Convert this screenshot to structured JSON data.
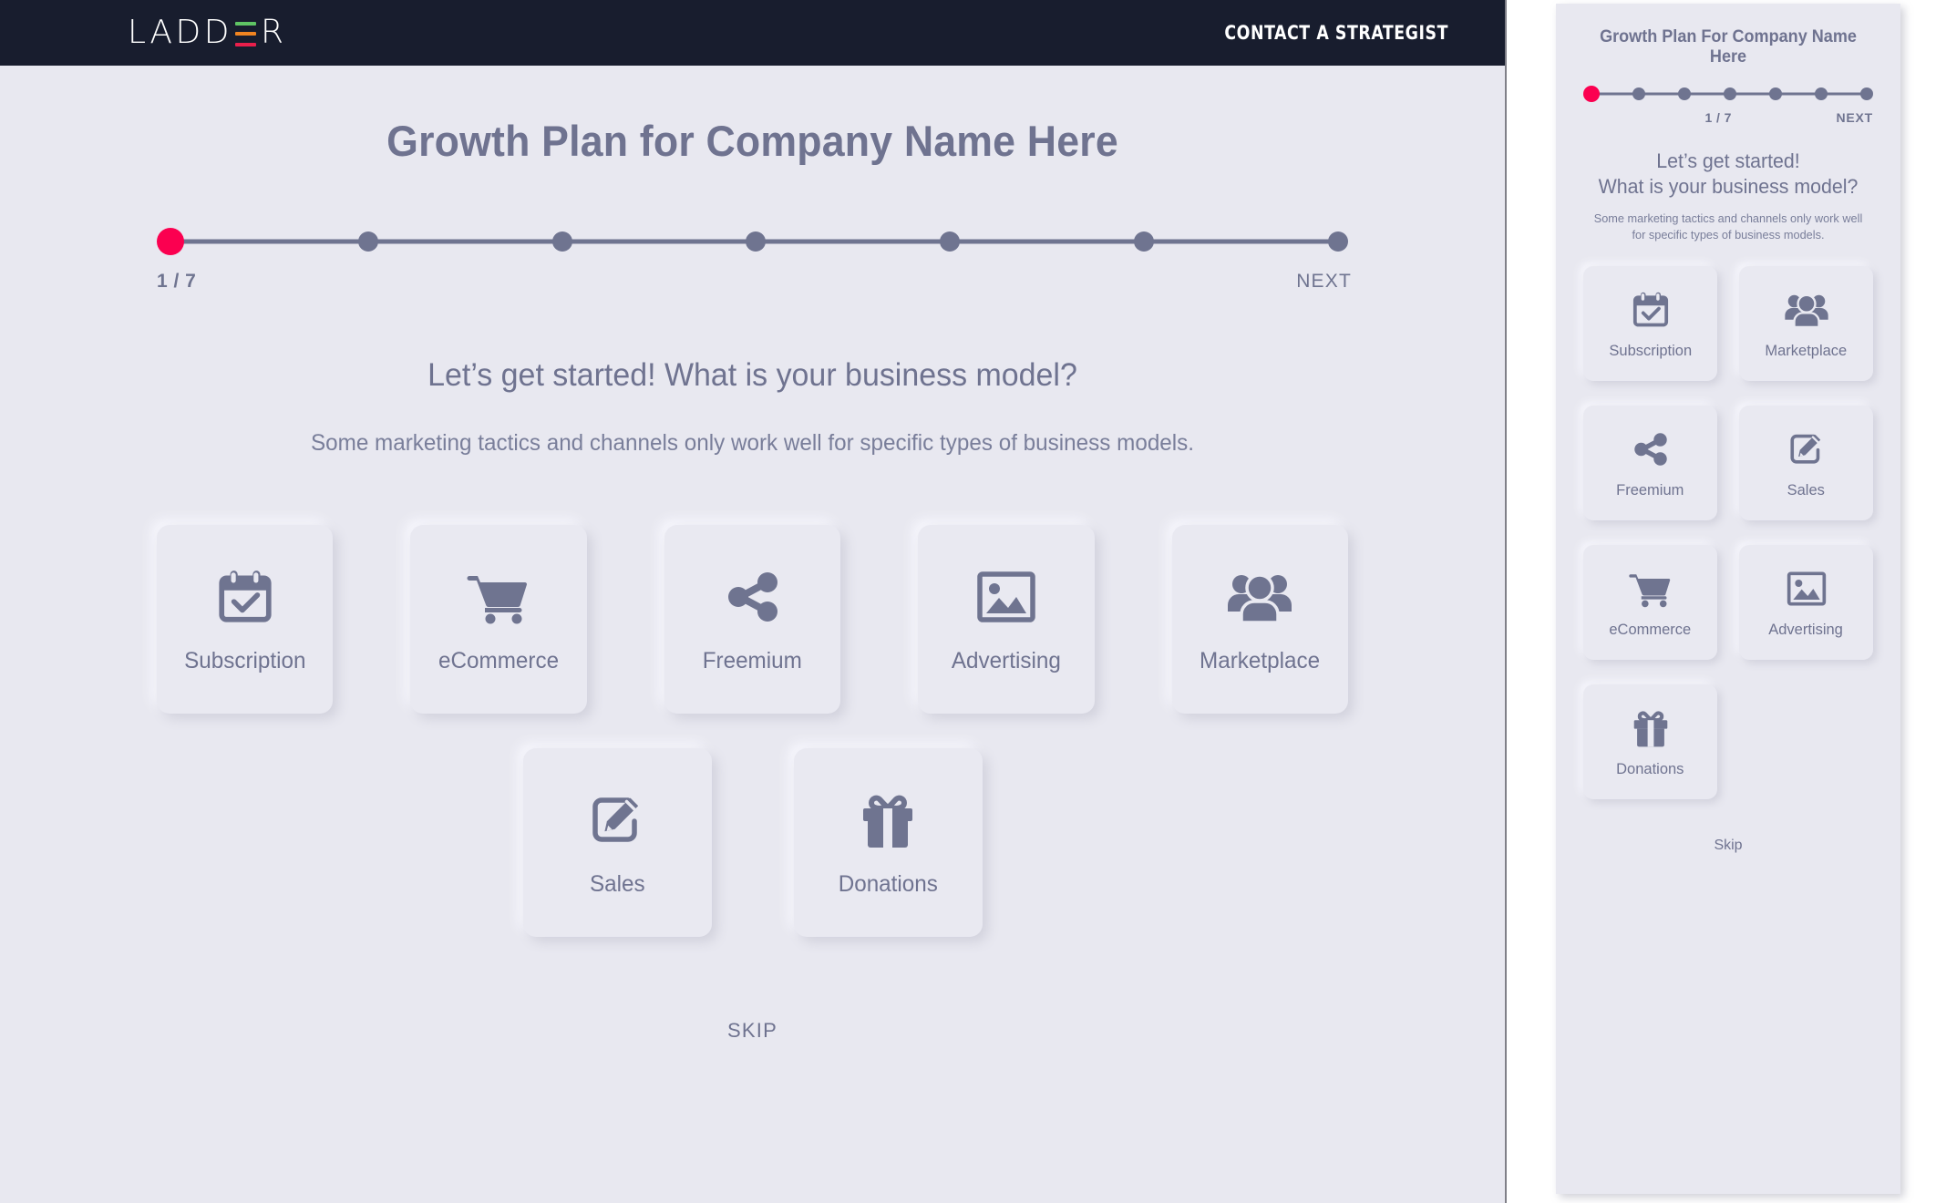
{
  "colors": {
    "page_background": "#e8e8f0",
    "topbar_background": "#181d2e",
    "accent_pink": "#fb0050",
    "muted_blue_gray": "#6f7490",
    "logo_bar_green": "#5fc464",
    "logo_bar_orange": "#f08421",
    "logo_bar_red": "#e91f4b",
    "card_background": "#e9e9f1"
  },
  "desktop": {
    "topbar": {
      "logo_text_before": "LADD",
      "logo_text_after": "R",
      "logo_icon": "ladder-e-bars",
      "contact_label": "CONTACT A STRATEGIST"
    },
    "page_title": "Growth Plan for Company Name Here",
    "progress": {
      "total_steps": 7,
      "current_step": 1,
      "step_label": "1 / 7",
      "next_label": "NEXT"
    },
    "question": "Let’s get started! What is your business model?",
    "subtext": "Some marketing tactics and channels only work well for specific types of business models.",
    "options_row1": [
      {
        "label": "Subscription",
        "icon": "calendar-check-icon"
      },
      {
        "label": "eCommerce",
        "icon": "shopping-cart-icon"
      },
      {
        "label": "Freemium",
        "icon": "share-icon"
      },
      {
        "label": "Advertising",
        "icon": "image-icon"
      },
      {
        "label": "Marketplace",
        "icon": "people-group-icon"
      }
    ],
    "options_row2": [
      {
        "label": "Sales",
        "icon": "pencil-square-icon"
      },
      {
        "label": "Donations",
        "icon": "gift-icon"
      }
    ],
    "skip_label": "SKIP"
  },
  "mobile": {
    "page_title": "Growth Plan For Company Name Here",
    "progress": {
      "total_steps": 7,
      "current_step": 1,
      "step_label": "1 / 7",
      "next_label": "NEXT"
    },
    "question_line1": "Let’s get started!",
    "question_line2": "What is your business model?",
    "subtext": "Some marketing tactics and channels only work well for specific types of business models.",
    "options": [
      {
        "label": "Subscription",
        "icon": "calendar-check-icon"
      },
      {
        "label": "Marketplace",
        "icon": "people-group-icon"
      },
      {
        "label": "Freemium",
        "icon": "share-icon"
      },
      {
        "label": "Sales",
        "icon": "pencil-square-icon"
      },
      {
        "label": "eCommerce",
        "icon": "shopping-cart-icon"
      },
      {
        "label": "Advertising",
        "icon": "image-icon"
      },
      {
        "label": "Donations",
        "icon": "gift-icon"
      }
    ],
    "skip_label": "Skip"
  }
}
